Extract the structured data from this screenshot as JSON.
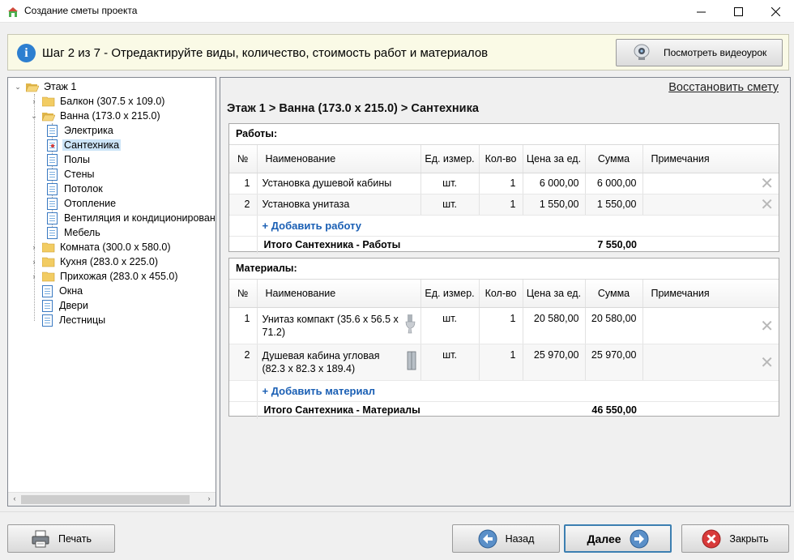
{
  "window": {
    "title": "Создание сметы проекта",
    "minimize": "—",
    "maximize": "☐",
    "close": "✕"
  },
  "banner": {
    "step_text": "Шаг 2 из 7 - Отредактируйте виды, количество, стоимость работ и материалов",
    "video_button": "Посмотреть видеоурок"
  },
  "tree": [
    {
      "label": "Этаж 1",
      "type": "folder",
      "expanded": true
    },
    {
      "label": "Балкон (307.5 x 109.0)",
      "type": "folder",
      "expanded": false
    },
    {
      "label": "Ванна (173.0 x 215.0)",
      "type": "folder",
      "expanded": true
    },
    {
      "label": "Электрика",
      "type": "page"
    },
    {
      "label": "Сантехника",
      "type": "page",
      "selected": true
    },
    {
      "label": "Полы",
      "type": "page"
    },
    {
      "label": "Стены",
      "type": "page"
    },
    {
      "label": "Потолок",
      "type": "page"
    },
    {
      "label": "Отопление",
      "type": "page"
    },
    {
      "label": "Вентиляция и кондиционирование",
      "type": "page"
    },
    {
      "label": "Мебель",
      "type": "page"
    },
    {
      "label": "Комната (300.0 x 580.0)",
      "type": "folder",
      "expanded": false
    },
    {
      "label": "Кухня (283.0 x 225.0)",
      "type": "folder",
      "expanded": false
    },
    {
      "label": "Прихожая (283.0 x 455.0)",
      "type": "folder",
      "expanded": false
    },
    {
      "label": "Окна",
      "type": "page"
    },
    {
      "label": "Двери",
      "type": "page"
    },
    {
      "label": "Лестницы",
      "type": "page"
    }
  ],
  "content": {
    "restore_link": "Восстановить смету",
    "breadcrumb": "Этаж 1 > Ванна (173.0 x 215.0) > Сантехника",
    "columns": [
      "№",
      "Наименование",
      "Ед. измер.",
      "Кол-во",
      "Цена за ед.",
      "Сумма",
      "Примечания"
    ],
    "works": {
      "title": "Работы:",
      "rows": [
        {
          "n": "1",
          "name": "Установка душевой кабины",
          "unit": "шт.",
          "qty": "1",
          "price": "6 000,00",
          "sum": "6 000,00",
          "note": ""
        },
        {
          "n": "2",
          "name": "Установка унитаза",
          "unit": "шт.",
          "qty": "1",
          "price": "1 550,00",
          "sum": "1 550,00",
          "note": ""
        }
      ],
      "add_label": "+ Добавить работу",
      "total_label": "Итого Сантехника - Работы",
      "total_value": "7 550,00"
    },
    "materials": {
      "title": "Материалы:",
      "rows": [
        {
          "n": "1",
          "name": "Унитаз компакт (35.6 x 56.5 x 71.2)",
          "unit": "шт.",
          "qty": "1",
          "price": "20 580,00",
          "sum": "20 580,00",
          "note": ""
        },
        {
          "n": "2",
          "name": "Душевая кабина угловая (82.3 x 82.3 x 189.4)",
          "unit": "шт.",
          "qty": "1",
          "price": "25 970,00",
          "sum": "25 970,00",
          "note": ""
        }
      ],
      "add_label": "+ Добавить материал",
      "total_label": "Итого Сантехника - Материалы",
      "total_value": "46 550,00"
    },
    "delete_glyph": "✕"
  },
  "buttons": {
    "print": "Печать",
    "back": "Назад",
    "next": "Далее",
    "close": "Закрыть"
  },
  "colors": {
    "banner_bg": "#fafae6",
    "selection": "#cce4f7",
    "link": "#1a5fb4",
    "primary_border": "#3c7fb1"
  }
}
